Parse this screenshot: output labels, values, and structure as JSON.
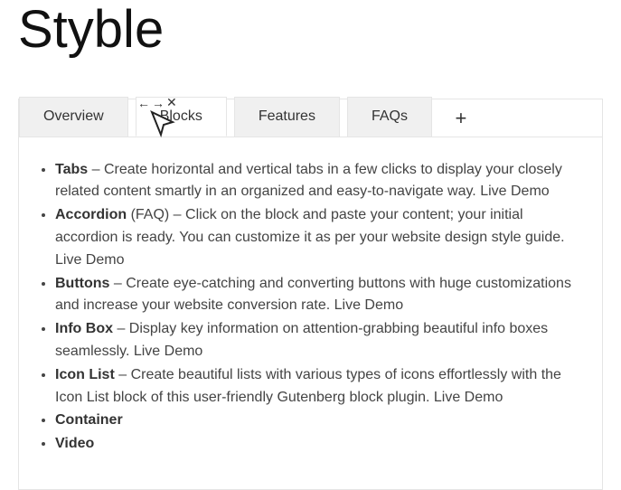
{
  "page_title": "Styble",
  "tabs": [
    {
      "label": "Overview",
      "active": false
    },
    {
      "label": "Blocks",
      "active": true
    },
    {
      "label": "Features",
      "active": false
    },
    {
      "label": "FAQs",
      "active": false
    }
  ],
  "block_items": [
    {
      "title": "Tabs",
      "desc": " – Create horizontal and vertical tabs in a few clicks to display your closely related content smartly in an organized and easy-to-navigate way. Live Demo"
    },
    {
      "title": "Accordion",
      "desc": " (FAQ) – Click on the block and paste your content; your initial accordion is ready. You can customize it as per your website design style guide. Live Demo"
    },
    {
      "title": "Buttons",
      "desc": " – Create eye-catching and converting buttons with huge customizations and increase your website conversion rate. Live Demo"
    },
    {
      "title": "Info Box",
      "desc": " – Display key information on attention-grabbing beautiful info boxes seamlessly. Live Demo"
    },
    {
      "title": "Icon List",
      "desc": " – Create beautiful lists with various types of icons effortlessly with the Icon List block of this user-friendly Gutenberg block plugin. Live Demo"
    },
    {
      "title": "Container",
      "desc": ""
    },
    {
      "title": "Video",
      "desc": ""
    }
  ],
  "toolbar": {
    "arrow_left": "←",
    "arrow_right": "→",
    "close": "✕",
    "add": "+"
  }
}
